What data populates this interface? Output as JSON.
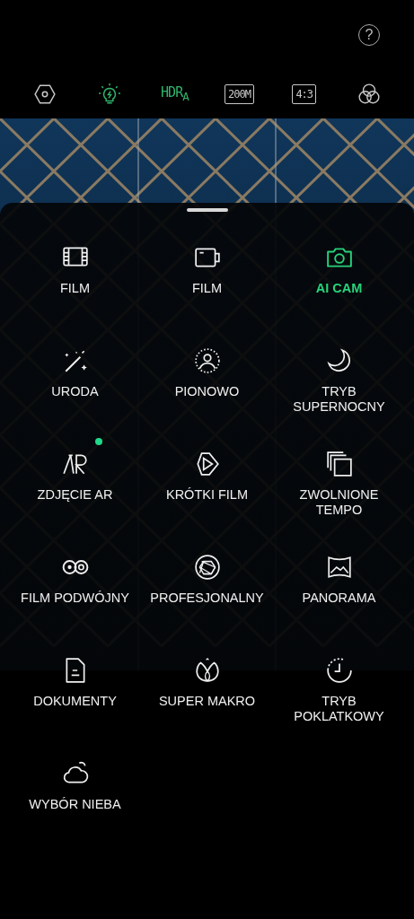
{
  "help": {
    "label": "?"
  },
  "toolbar": [
    {
      "kind": "icon",
      "on": false
    },
    {
      "kind": "icon",
      "on": true
    },
    {
      "kind": "text",
      "label": "HDR$_{A}$",
      "on": true
    },
    {
      "kind": "text",
      "label": "200M",
      "on": false
    },
    {
      "kind": "text",
      "label": "4:3",
      "on": false
    },
    {
      "kind": "icon",
      "on": false
    }
  ],
  "modes": [
    {
      "label": "FILM",
      "selected": false,
      "new_dot": false
    },
    {
      "label": "FILM",
      "selected": false,
      "new_dot": false
    },
    {
      "label": "AI CAM",
      "selected": true,
      "new_dot": false
    },
    {
      "label": "URODA",
      "selected": false,
      "new_dot": false
    },
    {
      "label": "PIONOWO",
      "selected": false,
      "new_dot": false
    },
    {
      "label": "TRYB SUPERNOCNY",
      "selected": false,
      "new_dot": false
    },
    {
      "label": "ZDJĘCIE AR",
      "selected": false,
      "new_dot": true
    },
    {
      "label": "KRÓTKI FILM",
      "selected": false,
      "new_dot": false
    },
    {
      "label": "ZWOLNIONE TEMPO",
      "selected": false,
      "new_dot": false
    },
    {
      "label": "FILM PODWÓJNY",
      "selected": false,
      "new_dot": false
    },
    {
      "label": "PROFESJONALNY",
      "selected": false,
      "new_dot": false
    },
    {
      "label": "PANORAMA",
      "selected": false,
      "new_dot": false
    },
    {
      "label": "DOKUMENTY",
      "selected": false,
      "new_dot": false
    },
    {
      "label": "SUPER MAKRO",
      "selected": false,
      "new_dot": false
    },
    {
      "label": "TRYB POKLATKOWY",
      "selected": false,
      "new_dot": false
    },
    {
      "label": "WYBÓR NIEBA",
      "selected": false,
      "new_dot": false
    }
  ]
}
